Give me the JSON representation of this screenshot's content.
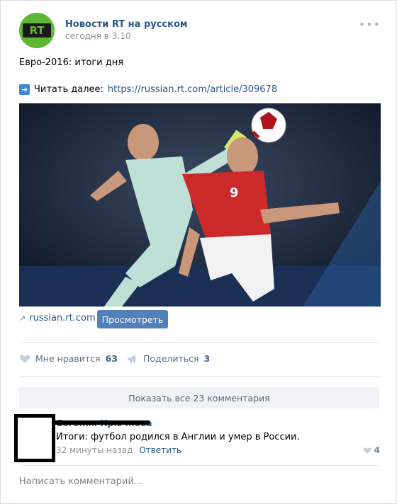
{
  "post": {
    "author": "Новости RT на русском",
    "avatar_text": "RT",
    "date": "сегодня в 3:10",
    "text": "Евро-2016: итоги дня",
    "read_more_prefix": "Читать далее:",
    "read_more_url": "https://russian.rt.com/article/309678",
    "source": "russian.rt.com",
    "view_button": "Просмотреть",
    "more_icon": "more-icon"
  },
  "actions": {
    "like_label": "Мне нравится",
    "like_count": "63",
    "share_label": "Поделиться",
    "share_count": "3"
  },
  "comments": {
    "show_all": "Показать все 23 комментария",
    "items": [
      {
        "author": "Евгения Крючкова",
        "text": "Итоги: футбол родился в Англии и умер в России.",
        "time": "32 минуты назад",
        "reply": "Ответить",
        "likes": "4"
      }
    ]
  },
  "composer": {
    "placeholder": "Написать комментарий..."
  },
  "colors": {
    "link": "#2a5885",
    "button": "#5181b8",
    "rt_green": "#5fb733"
  }
}
